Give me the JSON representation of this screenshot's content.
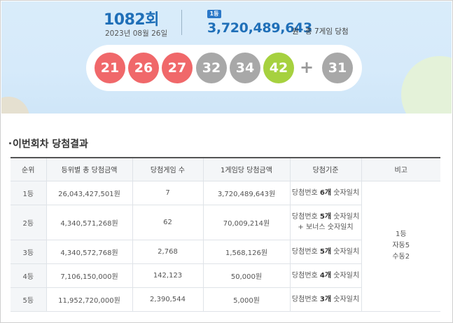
{
  "draw": {
    "number": "1082",
    "suffix": "회",
    "date": "2023년 08월 26일"
  },
  "first_prize": {
    "chip": "1등",
    "amount": "3,720,489,643",
    "unit": "원",
    "winners_note": "총 7게임 당첨"
  },
  "balls": [
    {
      "label": "21",
      "color": "#f0686a"
    },
    {
      "label": "26",
      "color": "#f0686a"
    },
    {
      "label": "27",
      "color": "#f0686a"
    },
    {
      "label": "32",
      "color": "#a8a8a8"
    },
    {
      "label": "34",
      "color": "#a8a8a8"
    },
    {
      "label": "42",
      "color": "#a6d13f"
    }
  ],
  "plus_sign": "+",
  "bonus_ball": {
    "label": "31",
    "color": "#a8a8a8"
  },
  "section": {
    "title": "이번회차 당첨결과"
  },
  "table": {
    "headers": [
      "순위",
      "등위별 총 당첨금액",
      "당첨게임 수",
      "1게임당 당첨금액",
      "당첨기준",
      "비고"
    ],
    "rows": [
      {
        "rank": "1등",
        "total": "26,043,427,501원",
        "games": "7",
        "per_game": "3,720,489,643원",
        "crit_a": "당첨번호 ",
        "crit_b": "6개",
        "crit_c": " 숫자일치",
        "crit_line2": ""
      },
      {
        "rank": "2등",
        "total": "4,340,571,268원",
        "games": "62",
        "per_game": "70,009,214원",
        "crit_a": "당첨번호 ",
        "crit_b": "5개",
        "crit_c": " 숫자일치",
        "crit_line2": "+ 보너스 숫자일치"
      },
      {
        "rank": "3등",
        "total": "4,340,572,768원",
        "games": "2,768",
        "per_game": "1,568,126원",
        "crit_a": "당첨번호 ",
        "crit_b": "5개",
        "crit_c": " 숫자일치",
        "crit_line2": ""
      },
      {
        "rank": "4등",
        "total": "7,106,150,000원",
        "games": "142,123",
        "per_game": "50,000원",
        "crit_a": "당첨번호 ",
        "crit_b": "4개",
        "crit_c": " 숫자일치",
        "crit_line2": ""
      },
      {
        "rank": "5등",
        "total": "11,952,720,000원",
        "games": "2,390,544",
        "per_game": "5,000원",
        "crit_a": "당첨번호 ",
        "crit_b": "3개",
        "crit_c": " 숫자일치",
        "crit_line2": ""
      }
    ],
    "note": {
      "line1": "1등",
      "line2": "자동5",
      "line3": "수동2"
    }
  }
}
